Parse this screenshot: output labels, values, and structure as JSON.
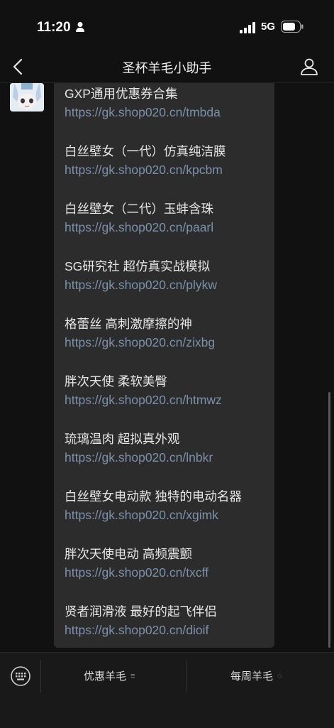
{
  "status": {
    "time": "11:20",
    "network": "5G"
  },
  "header": {
    "title": "圣杯羊毛小助手"
  },
  "messages": [
    {
      "title": "GXP通用优惠券合集",
      "link": "https://gk.shop020.cn/tmbda"
    },
    {
      "title": "白丝壁女（一代）仿真纯洁膜",
      "link": "https://gk.shop020.cn/kpcbm"
    },
    {
      "title": "白丝壁女（二代）玉蚌含珠",
      "link": "https://gk.shop020.cn/paarl"
    },
    {
      "title": "SG研究社 超仿真实战模拟",
      "link": "https://gk.shop020.cn/plykw"
    },
    {
      "title": "格蕾丝 高刺激摩擦的神",
      "link": "https://gk.shop020.cn/zixbg"
    },
    {
      "title": "胖次天使 柔软美臀",
      "link": "https://gk.shop020.cn/htmwz"
    },
    {
      "title": "琉璃温肉 超拟真外观",
      "link": "https://gk.shop020.cn/lnbkr"
    },
    {
      "title": "白丝壁女电动款 独特的电动名器",
      "link": "https://gk.shop020.cn/xgimk"
    },
    {
      "title": "胖次天使电动 高频震颤",
      "link": "https://gk.shop020.cn/txcff"
    },
    {
      "title": "贤者润滑液 最好的起飞伴侣",
      "link": "https://gk.shop020.cn/dioif"
    }
  ],
  "bottom_menu": {
    "menu1": "优惠羊毛",
    "menu1_icon": "≡",
    "menu2": "每周羊毛",
    "menu2_icon": "◌"
  }
}
